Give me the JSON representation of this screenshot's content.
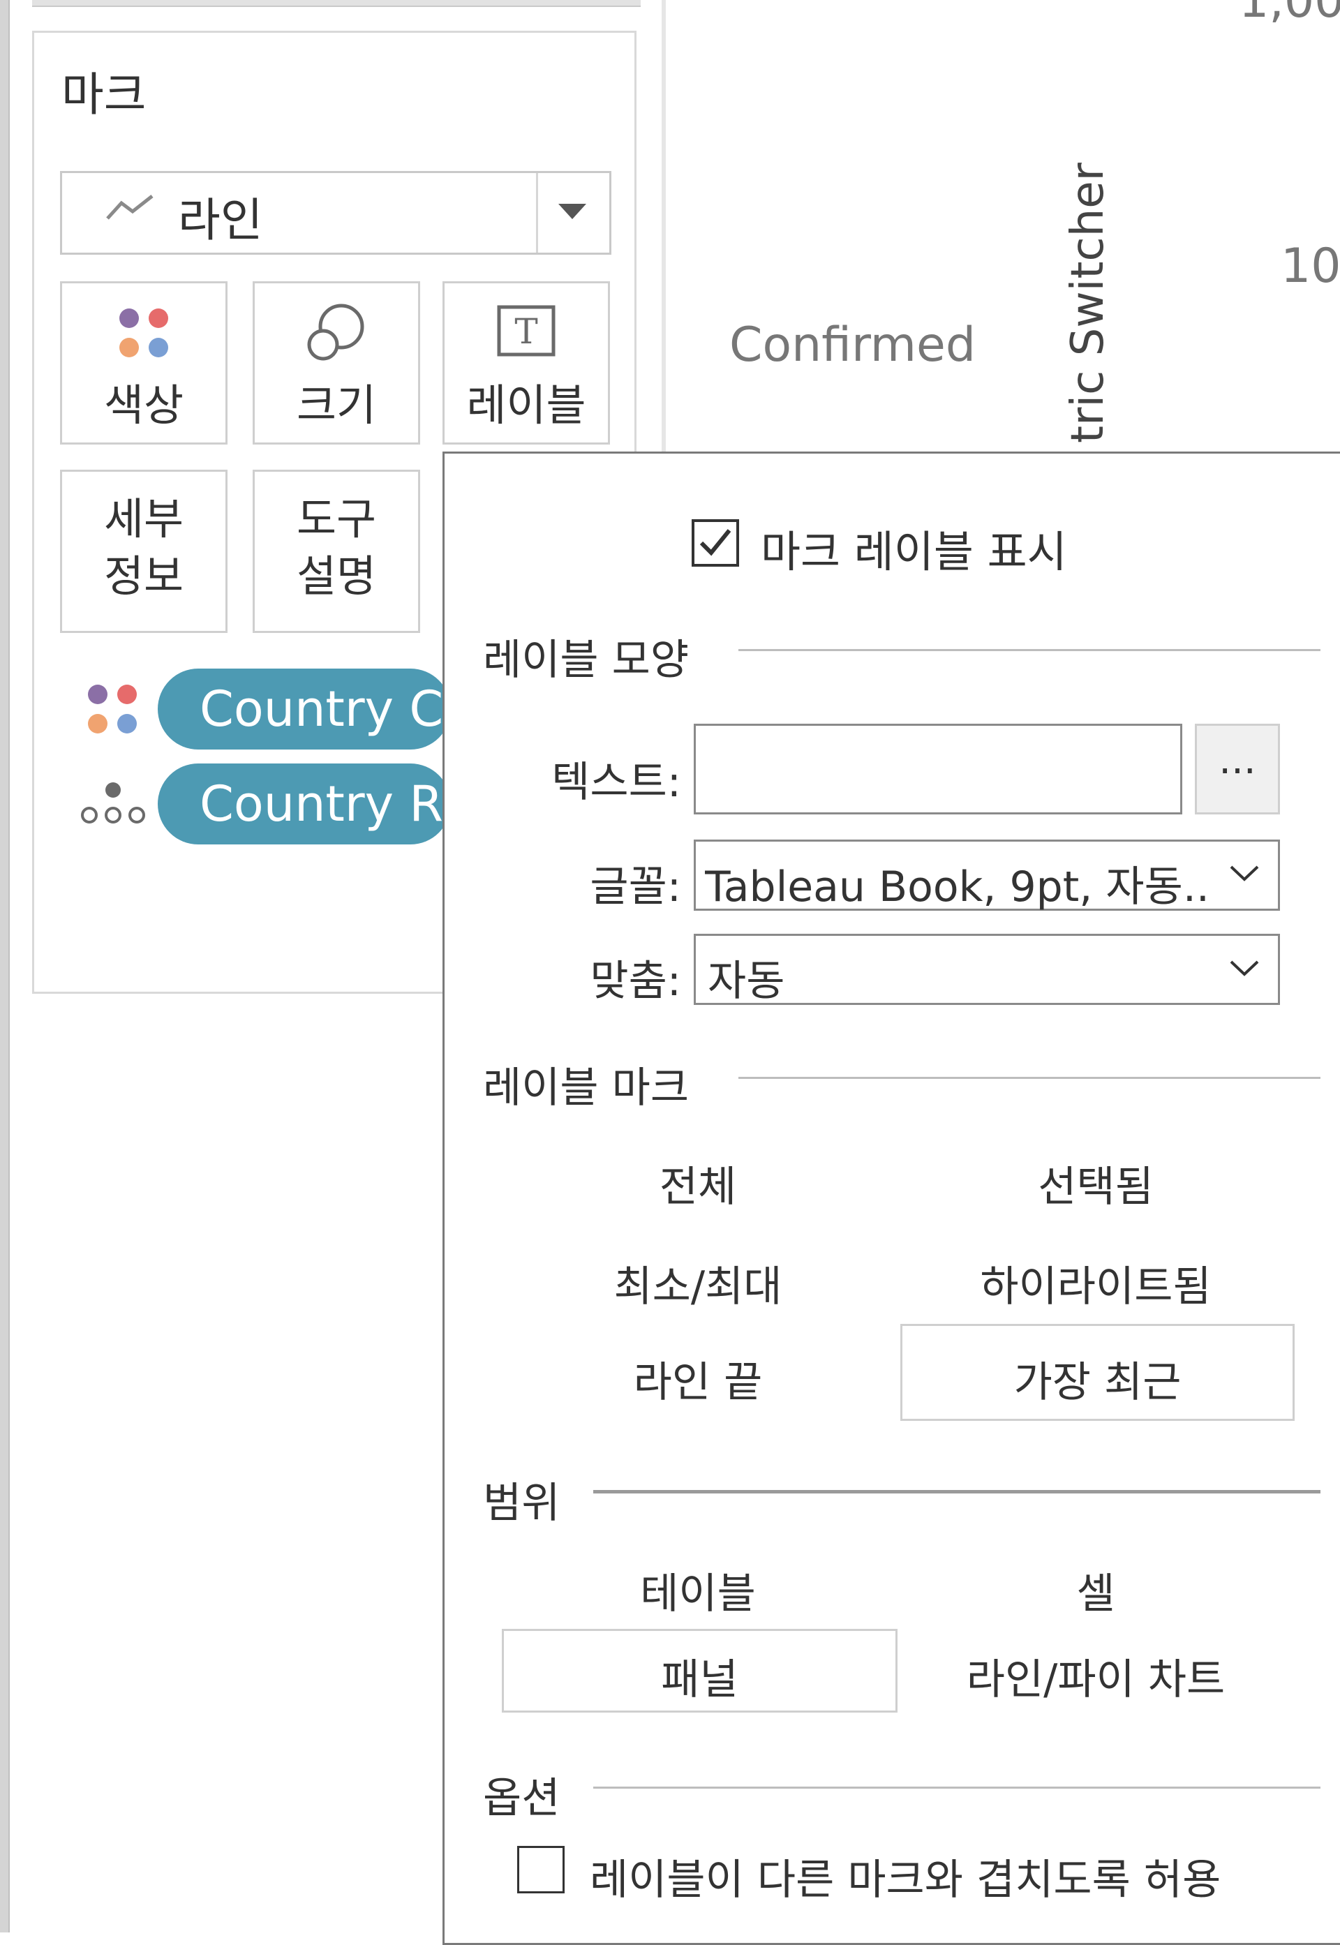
{
  "marks_card": {
    "title": "마크",
    "mark_type": {
      "label": "라인",
      "icon": "line-chart-icon"
    },
    "buttons": [
      {
        "label": "색상",
        "icon": "color-dots-icon"
      },
      {
        "label": "크기",
        "icon": "size-circles-icon"
      },
      {
        "label": "레이블",
        "icon": "text-label-icon"
      },
      {
        "label_line1": "세부",
        "label_line2": "정보"
      },
      {
        "label_line1": "도구",
        "label_line2": "설명"
      }
    ],
    "pills": [
      {
        "label": "Country Co",
        "icon": "color-dots-icon"
      },
      {
        "label": "Country Re",
        "icon": "detail-dots-icon"
      }
    ]
  },
  "chart": {
    "tick_top": "1,00",
    "tick_mid": "10",
    "row_label": "Confirmed",
    "vertical_header": "tric Switcher"
  },
  "label_popup": {
    "show_labels": {
      "label": "마크 레이블 표시",
      "checked": true
    },
    "appearance": {
      "section_title": "레이블 모양",
      "text_label": "텍스트:",
      "text_value": "",
      "ellipsis_button": "...",
      "font_label": "글꼴:",
      "font_value": "Tableau Book, 9pt, 자동..",
      "align_label": "맞춤:",
      "align_value": "자동"
    },
    "marks_to_label": {
      "section_title": "레이블 마크",
      "options": [
        "전체",
        "선택됨",
        "최소/최대",
        "하이라이트됨",
        "라인 끝",
        "가장 최근"
      ],
      "selected": "가장 최근"
    },
    "scope": {
      "section_title": "범위",
      "options": [
        "테이블",
        "셀",
        "패널",
        "라인/파이 차트"
      ],
      "selected": "패널"
    },
    "options": {
      "section_title": "옵션",
      "overlap_label": "레이블이 다른 마크와 겹치도록 허용",
      "overlap_checked": false
    }
  },
  "colors": {
    "pill": "#4d9ab3",
    "dot_purple": "#8b6fa6",
    "dot_red": "#e66b6b",
    "dot_orange": "#f0a370",
    "dot_blue": "#7a9fd4"
  }
}
